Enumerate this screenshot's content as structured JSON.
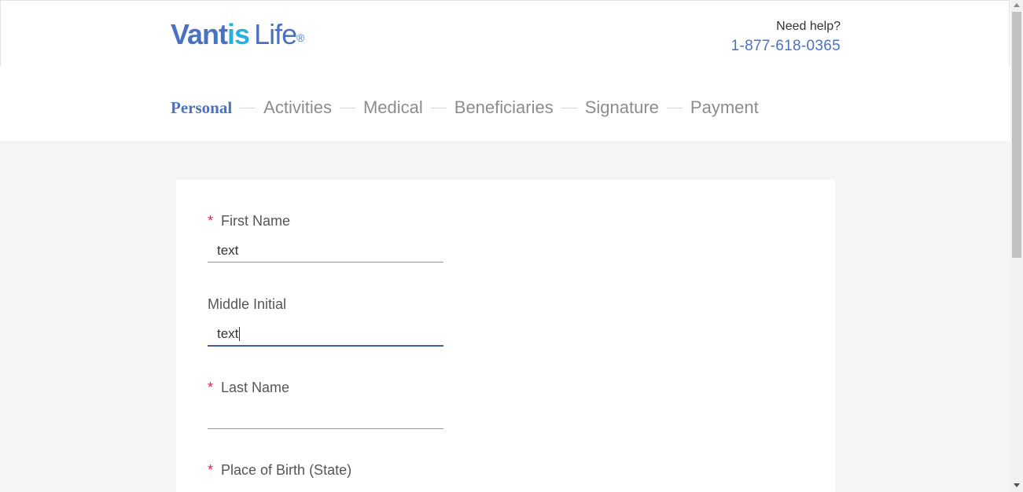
{
  "header": {
    "logo": {
      "part_a": "Vant",
      "part_b": "is",
      "part_c": "Life",
      "reg": "®"
    },
    "help_label": "Need help?",
    "help_phone": "1-877-618-0365"
  },
  "steps": [
    {
      "label": "Personal",
      "active": true
    },
    {
      "label": "Activities",
      "active": false
    },
    {
      "label": "Medical",
      "active": false
    },
    {
      "label": "Beneficiaries",
      "active": false
    },
    {
      "label": "Signature",
      "active": false
    },
    {
      "label": "Payment",
      "active": false
    }
  ],
  "form": {
    "required_marker": "*",
    "first_name": {
      "label": "First Name",
      "value": "text",
      "required": true
    },
    "middle_initial": {
      "label": "Middle Initial",
      "value": "text",
      "required": false,
      "focused": true
    },
    "last_name": {
      "label": "Last Name",
      "value": "",
      "required": true
    },
    "place_of_birth": {
      "label": "Place of Birth (State)",
      "value": "",
      "required": true
    }
  },
  "colors": {
    "brand": "#4a72c0",
    "brand_accent": "#29b0e0",
    "required": "#e0234e",
    "step_inactive": "#8c8c8c"
  }
}
